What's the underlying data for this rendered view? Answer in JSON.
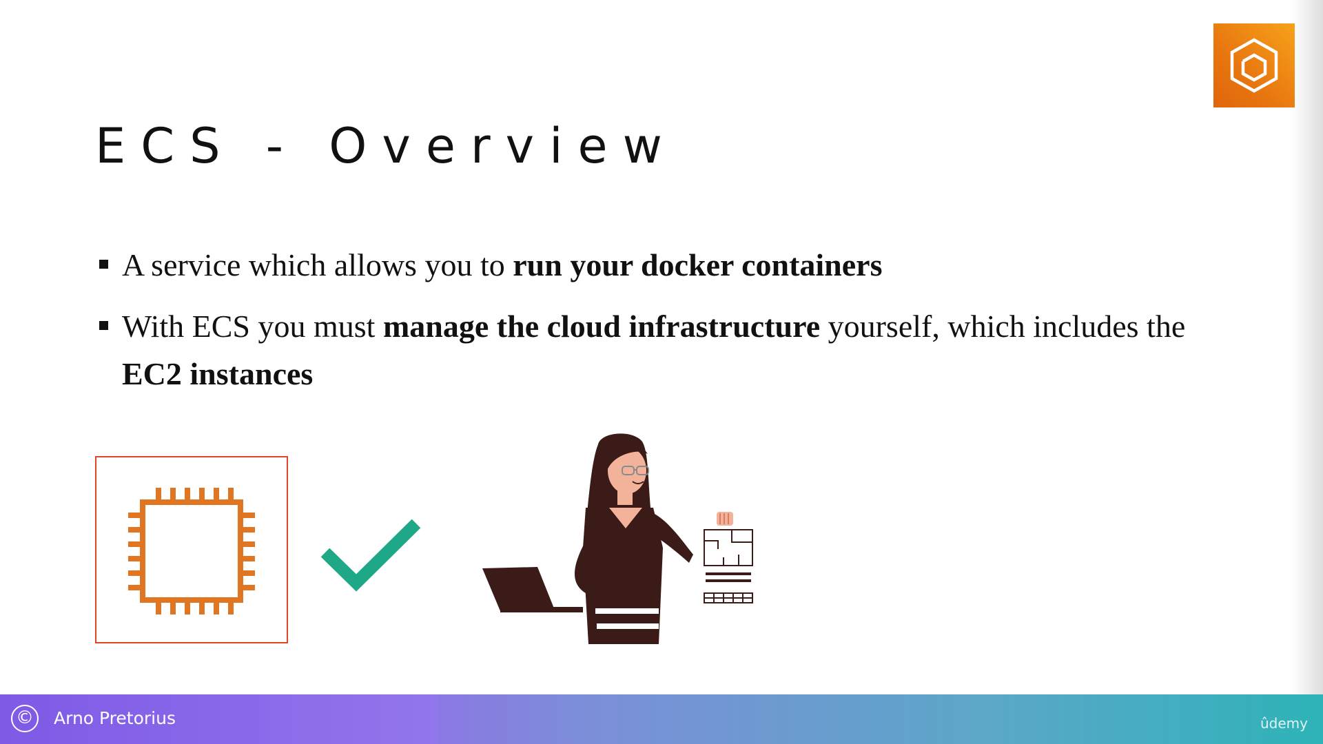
{
  "slide": {
    "title": "ECS - Overview",
    "bullets": [
      {
        "parts": {
          "p1": "A service which allows you to ",
          "p2": "run your docker containers"
        }
      },
      {
        "parts": {
          "p1": "With ECS you must ",
          "p2": "manage the cloud infrastructure",
          "p3": " yourself, which includes the ",
          "p4": "EC2 instances"
        }
      }
    ]
  },
  "icons": {
    "service_badge": "ecs-service-icon",
    "chip": "ec2-instance-chip-icon",
    "check": "checkmark-icon",
    "person": "person-with-laptop-illustration"
  },
  "colors": {
    "badge_orange": "#e8770f",
    "chip_orange": "#e07522",
    "box_border": "#e0442a",
    "check_green": "#1fa887",
    "footer_purple": "#8e6bea",
    "footer_teal": "#2eb3b8"
  },
  "footer": {
    "copyright_symbol": "©",
    "author": "Arno Pretorius",
    "brand": "ûdemy"
  }
}
